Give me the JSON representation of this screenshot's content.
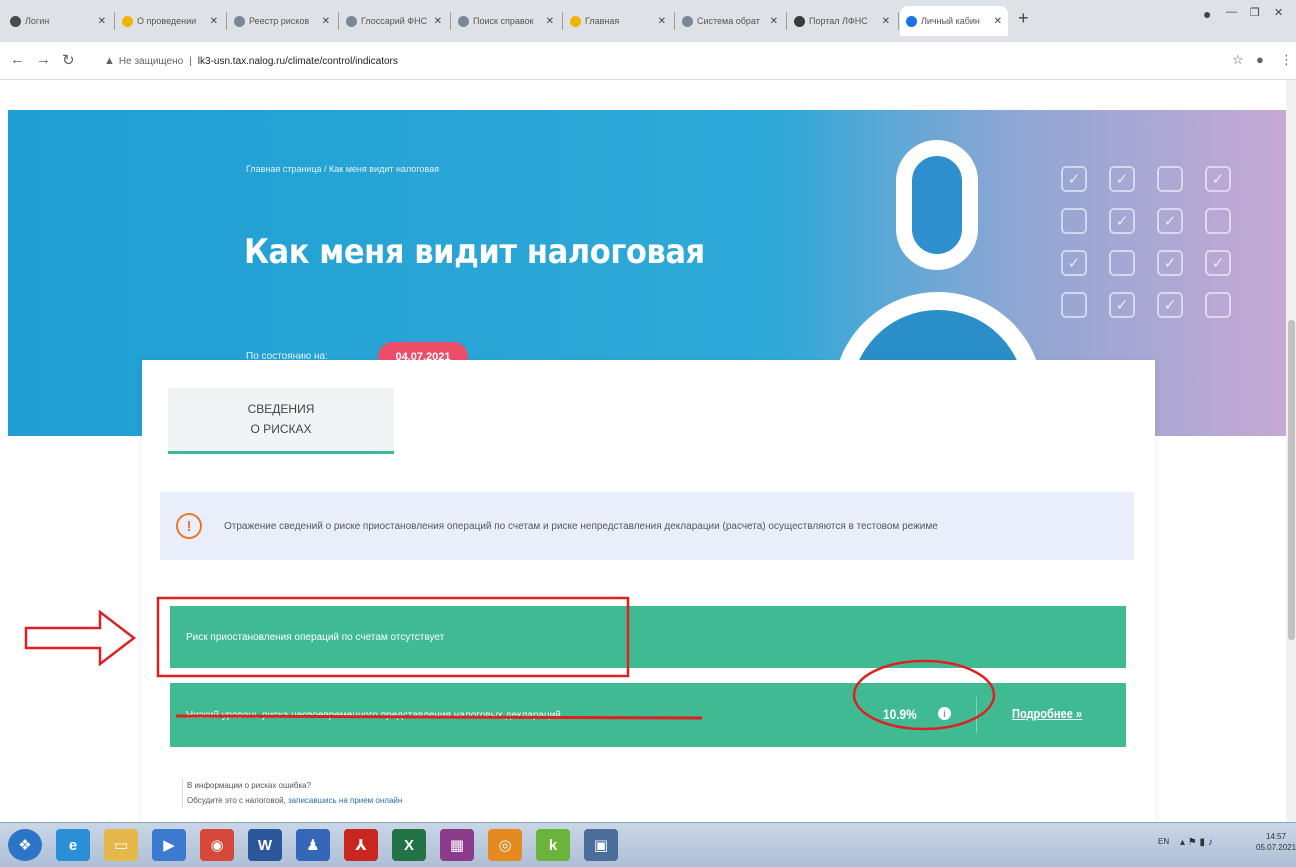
{
  "browser": {
    "tabs": [
      {
        "label": "Логин",
        "color": "#4a4a4a"
      },
      {
        "label": "О проведении",
        "color": "#f0b400"
      },
      {
        "label": "Реестр рисков",
        "color": "#7a8796"
      },
      {
        "label": "Глоссарий ФНС",
        "color": "#7a8796"
      },
      {
        "label": "Поиск справок",
        "color": "#7a8796"
      },
      {
        "label": "Главная",
        "color": "#f0b400"
      },
      {
        "label": "Система обрат",
        "color": "#7a8796"
      },
      {
        "label": "Портал ЛФНС",
        "color": "#3a3a3a"
      },
      {
        "label": "Личный кабин",
        "color": "#1a73e8"
      }
    ],
    "address": {
      "security": "Не защищено",
      "url": "lk3-usn.tax.nalog.ru/climate/control/indicators"
    }
  },
  "page": {
    "breadcrumb": "Главная страница / Как меня видит налоговая",
    "title": "Как меня видит налоговая",
    "asof_label": "По состоянию на:",
    "asof_date": "04.07.2021",
    "tab_line1": "СВЕДЕНИЯ",
    "tab_line2": "О РИСКАХ",
    "notice": "Отражение сведений о риске приостановления операций по счетам и риске непредставления декларации (расчета) осуществляются в тестовом режиме",
    "risk_accounts": "Риск приостановления операций по счетам отсутствует",
    "risk_declarations": "Низкий уровень риска несвоевременного представления налоговых деклараций",
    "risk_percent": "10.9%",
    "more_link": "Подробнее »",
    "footnote_line1": "В информации о рисках ошибка?",
    "footnote_line2_prefix": "Обсудите это с налоговой, ",
    "footnote_link": "записавшись на прием онлайн"
  },
  "checkbox_states": [
    true,
    true,
    false,
    true,
    false,
    true,
    true,
    false,
    true,
    false,
    true,
    true,
    false,
    true,
    true,
    false
  ],
  "taskbar": {
    "apps": [
      {
        "name": "start",
        "color": "#2b74c8",
        "glyph": "❖"
      },
      {
        "name": "ie",
        "color": "#2a8fd6",
        "glyph": "e"
      },
      {
        "name": "explorer",
        "color": "#e6b84a",
        "glyph": "▭"
      },
      {
        "name": "media",
        "color": "#3c7ad1",
        "glyph": "▶"
      },
      {
        "name": "chrome",
        "color": "#d4493a",
        "glyph": "◉"
      },
      {
        "name": "word",
        "color": "#2b579a",
        "glyph": "W"
      },
      {
        "name": "app-blue",
        "color": "#3566b8",
        "glyph": "♟"
      },
      {
        "name": "acrobat",
        "color": "#c8261e",
        "glyph": "⅄"
      },
      {
        "name": "excel",
        "color": "#217346",
        "glyph": "X"
      },
      {
        "name": "app-multi",
        "color": "#8a3b8a",
        "glyph": "▦"
      },
      {
        "name": "app-orange",
        "color": "#e48a21",
        "glyph": "◎"
      },
      {
        "name": "app-k",
        "color": "#6bb33a",
        "glyph": "k"
      },
      {
        "name": "app-monitor",
        "color": "#4a6d9a",
        "glyph": "▣"
      }
    ],
    "clock": "14:57",
    "date": "05.07.2021",
    "lang": "EN"
  },
  "colors": {
    "accent_green": "#3fba92",
    "date_pill": "#ec4e69",
    "annotation_red": "#e02020"
  }
}
